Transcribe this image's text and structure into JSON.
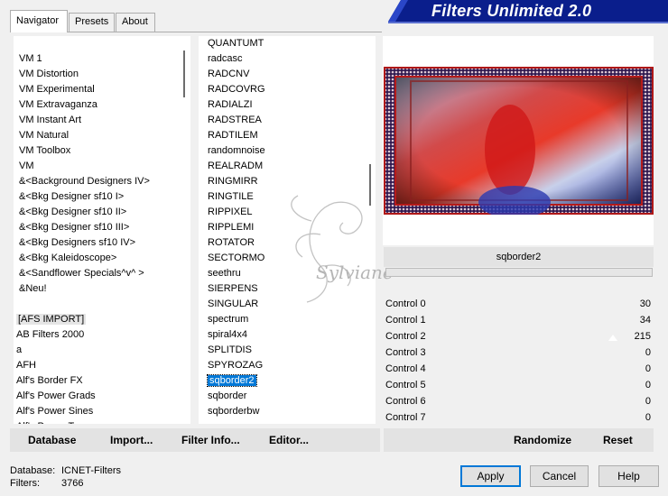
{
  "tabs": [
    "Navigator",
    "Presets",
    "About"
  ],
  "title": "Filters Unlimited 2.0",
  "categories": [
    "VM 1",
    "VM Distortion",
    "VM Experimental",
    "VM Extravaganza",
    "VM Instant Art",
    "VM Natural",
    "VM Toolbox",
    "VM",
    "&<Background Designers IV>",
    "&<Bkg Designer sf10 I>",
    "&<Bkg Designer sf10 II>",
    "&<Bkg Designer sf10 III>",
    "&<Bkg Designers sf10 IV>",
    "&<Bkg Kaleidoscope>",
    "&<Sandflower Specials^v^ >",
    "&Neu!",
    "",
    "[AFS IMPORT]",
    "AB Filters 2000",
    "a",
    "AFH",
    "Alf's Border FX",
    "Alf's Power Grads",
    "Alf's Power Sines",
    "Alf's Power Toys"
  ],
  "filters": [
    "QUANTUMT",
    "radcasc",
    "RADCNV",
    "RADCOVRG",
    "RADIALZI",
    "RADSTREA",
    "RADTILEM",
    "randomnoise",
    "REALRADM",
    "RINGMIRR",
    "RINGTILE",
    "RIPPIXEL",
    "RIPPLEMI",
    "ROTATOR",
    "SECTORMO",
    "seethru",
    "SIERPENS",
    "SINGULAR",
    "spectrum",
    "spiral4x4",
    "SPLITDIS",
    "SPYROZAG",
    "sqborder2",
    "sqborder",
    "sqborderbw"
  ],
  "selected_filter": "sqborder2",
  "selected_category": "[AFS IMPORT]",
  "filter_name": "sqborder2",
  "watermark": "Sylviane",
  "controls": [
    {
      "label": "Control 0",
      "value": "30"
    },
    {
      "label": "Control 1",
      "value": "34"
    },
    {
      "label": "Control 2",
      "value": "215"
    },
    {
      "label": "Control 3",
      "value": "0"
    },
    {
      "label": "Control 4",
      "value": "0"
    },
    {
      "label": "Control 5",
      "value": "0"
    },
    {
      "label": "Control 6",
      "value": "0"
    },
    {
      "label": "Control 7",
      "value": "0"
    }
  ],
  "bottom_buttons": {
    "database": "Database",
    "import": "Import...",
    "filter_info": "Filter Info...",
    "editor": "Editor...",
    "randomize": "Randomize",
    "reset": "Reset"
  },
  "status": {
    "database_label": "Database:",
    "database_value": "ICNET-Filters",
    "filters_label": "Filters:",
    "filters_value": "3766"
  },
  "dialog_buttons": {
    "apply": "Apply",
    "cancel": "Cancel",
    "help": "Help"
  },
  "colors": {
    "accent": "#0078d7",
    "banner": "#0a1e8c"
  }
}
